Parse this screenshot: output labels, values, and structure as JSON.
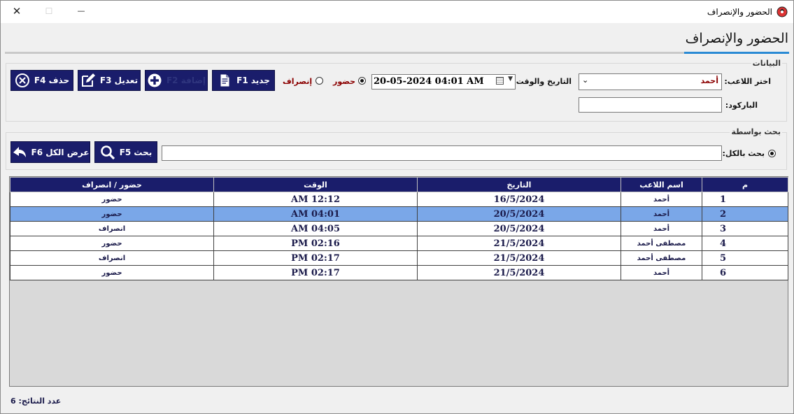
{
  "window": {
    "title": "الحضور والإنصراف",
    "minimize": "—",
    "maximize": "☐",
    "close": "✕"
  },
  "page": {
    "title": "الحضور والإنصراف"
  },
  "data_group": {
    "legend": "البيانات",
    "player_label": "اختر اللاعب:",
    "player_value": "أحمد",
    "datetime_label": "التاريخ والوقت:",
    "datetime_value": "20-05-2024 04:01 AM",
    "attend_label": "حضور",
    "leave_label": "إنصراف",
    "attend_selected": true,
    "barcode_label": "الباركود:",
    "barcode_value": "",
    "buttons": {
      "new": "جديد F1",
      "add": "إضافة F2",
      "edit": "تعديل F3",
      "delete": "حذف F4"
    }
  },
  "search_group": {
    "legend": "بحث بواسطة",
    "search_all_label": "بحث بالكل:",
    "search_value": "",
    "search_button": "بحث F5",
    "show_all_button": "عرض الكل F6"
  },
  "table": {
    "headers": {
      "num": "م",
      "name": "اسم اللاعب",
      "date": "التاريخ",
      "time": "الوقت",
      "status": "حضور / انصراف"
    },
    "rows": [
      {
        "num": "1",
        "name": "أحمد",
        "date": "16/5/2024",
        "time": "AM 12:12",
        "status": "حضور"
      },
      {
        "num": "2",
        "name": "أحمد",
        "date": "20/5/2024",
        "time": "AM 04:01",
        "status": "حضور"
      },
      {
        "num": "3",
        "name": "أحمد",
        "date": "20/5/2024",
        "time": "AM 04:05",
        "status": "انصراف"
      },
      {
        "num": "4",
        "name": "مصطفى أحمد",
        "date": "21/5/2024",
        "time": "PM 02:16",
        "status": "حضور"
      },
      {
        "num": "5",
        "name": "مصطفى أحمد",
        "date": "21/5/2024",
        "time": "PM 02:17",
        "status": "انصراف"
      },
      {
        "num": "6",
        "name": "أحمد",
        "date": "21/5/2024",
        "time": "PM 02:17",
        "status": "حضور"
      }
    ],
    "selected_row": 2
  },
  "status_bar": {
    "count_label": "عدد النتائج:",
    "count_value": "6"
  },
  "colors": {
    "navy": "#1a1d6b",
    "selection": "#7aa7e8",
    "accent": "#2a8ad4",
    "leave_text": "#8b0000"
  }
}
